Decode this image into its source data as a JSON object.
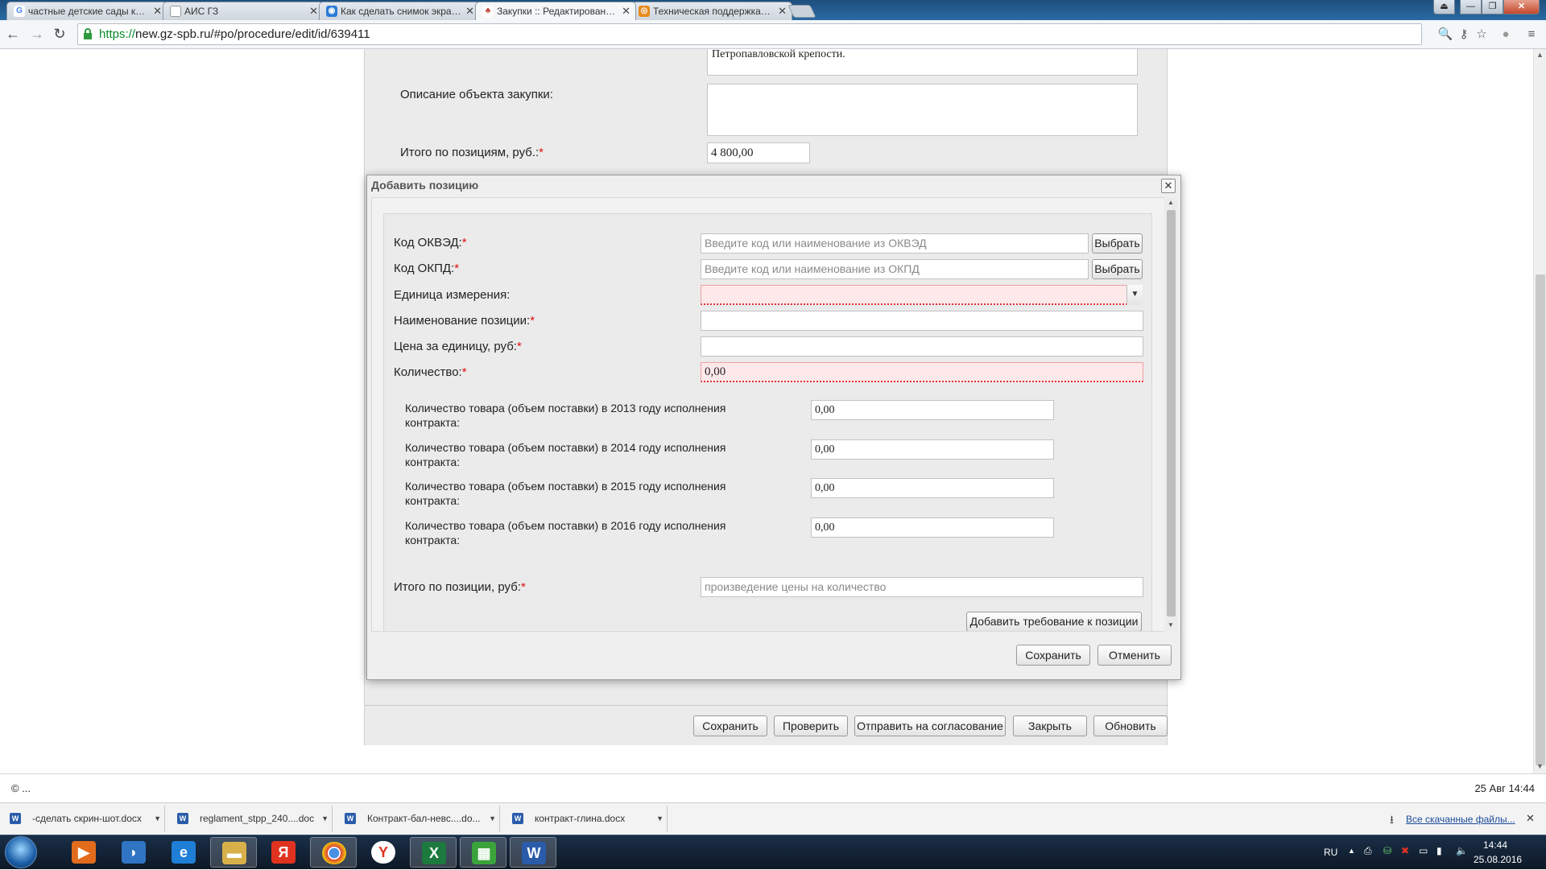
{
  "browser": {
    "tabs": [
      {
        "title": "частные детские сады к…",
        "favicon": "google-icon"
      },
      {
        "title": "АИС ГЗ",
        "favicon": "page-icon"
      },
      {
        "title": "Как сделать снимок экра…",
        "favicon": "globe-icon"
      },
      {
        "title": "Закупки :: Редактирован…",
        "favicon": "procurement-icon",
        "active": true
      },
      {
        "title": "Техническая поддержка…",
        "favicon": "support-icon"
      }
    ],
    "url_scheme": "https://",
    "url_rest": "new.gz-spb.ru/#po/procedure/edit/id/639411"
  },
  "background_form": {
    "top_text": "Петропавловской крепости.",
    "description_label": "Описание объекта закупки:",
    "total_label": "Итого по позициям, руб.:",
    "total_value": "4 800,00",
    "buttons": {
      "save": "Сохранить",
      "check": "Проверить",
      "send": "Отправить на согласование",
      "close": "Закрыть",
      "refresh": "Обновить"
    }
  },
  "modal": {
    "title": "Добавить позицию",
    "okved_label": "Код ОКВЭД:",
    "okved_placeholder": "Введите код или наименование из ОКВЭД",
    "okpd_label": "Код ОКПД:",
    "okpd_placeholder": "Введите код или наименование из ОКПД",
    "choose_label": "Выбрать",
    "unit_label": "Единица измерения:",
    "unit_value": "",
    "name_label": "Наименование позиции:",
    "name_value": "",
    "price_label": "Цена за единицу, руб:",
    "price_value": "",
    "qty_label": "Количество:",
    "qty_value": "0,00",
    "yearly": [
      {
        "label": "Количество товара (объем поставки) в 2013 году исполнения контракта:",
        "value": "0,00"
      },
      {
        "label": "Количество товара (объем поставки) в 2014 году исполнения контракта:",
        "value": "0,00"
      },
      {
        "label": "Количество товара (объем поставки) в 2015 году исполнения контракта:",
        "value": "0,00"
      },
      {
        "label": "Количество товара (объем поставки) в 2016 году исполнения контракта:",
        "value": "0,00"
      }
    ],
    "total_label": "Итого по позиции, руб:",
    "total_placeholder": "произведение цены на количество",
    "add_req_label": "Добавить требование к позиции",
    "save_label": "Сохранить",
    "cancel_label": "Отменить",
    "required_mark": "*"
  },
  "statusbar": {
    "left": "© ...",
    "right": "25 Авг 14:44"
  },
  "downloads": {
    "items": [
      "-сделать скрин-шот.docx",
      "reglament_stpp_240....doc",
      "Контракт-бал-невс....do...",
      "контракт-глина.docx"
    ],
    "all_label": "Все скачанные файлы..."
  },
  "taskbar": {
    "lang": "RU",
    "time": "14:44",
    "date": "25.08.2016"
  },
  "colors": {
    "required": "#e01010",
    "invalid_bg": "#fde9ea",
    "https": "#0a8a2a"
  }
}
